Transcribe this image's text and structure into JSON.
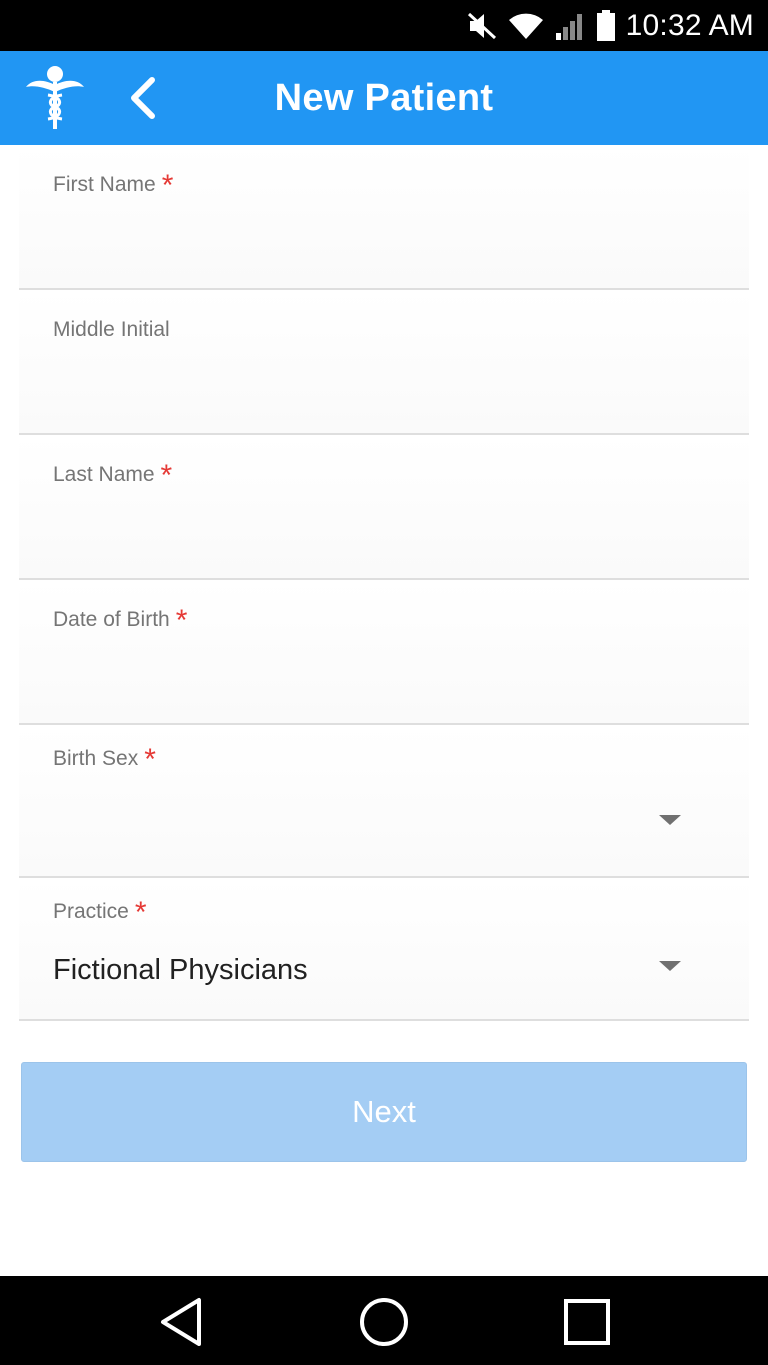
{
  "status_bar": {
    "time": "10:32 AM",
    "icons": [
      "mute-icon",
      "wifi-icon",
      "signal-icon",
      "battery-icon"
    ]
  },
  "app_bar": {
    "title": "New Patient",
    "logo_icon": "caduceus-icon",
    "back_icon": "chevron-left-icon",
    "color": "#2196f3"
  },
  "form": {
    "fields": [
      {
        "label": "First Name",
        "required": "*",
        "value": ""
      },
      {
        "label": "Middle Initial",
        "required": "",
        "value": ""
      },
      {
        "label": "Last Name",
        "required": "*",
        "value": ""
      },
      {
        "label": "Date of Birth",
        "required": "*",
        "value": ""
      },
      {
        "label": "Birth Sex",
        "required": "*",
        "value": ""
      },
      {
        "label": "Practice",
        "required": "*",
        "value": "Fictional Physicians"
      }
    ],
    "next_label": "Next"
  },
  "nav_bar": {
    "icons": [
      "back-triangle-icon",
      "home-circle-icon",
      "recents-square-icon"
    ]
  },
  "colors": {
    "primary": "#2196f3",
    "required": "#e53935",
    "button_disabled": "#a4cdf4"
  }
}
